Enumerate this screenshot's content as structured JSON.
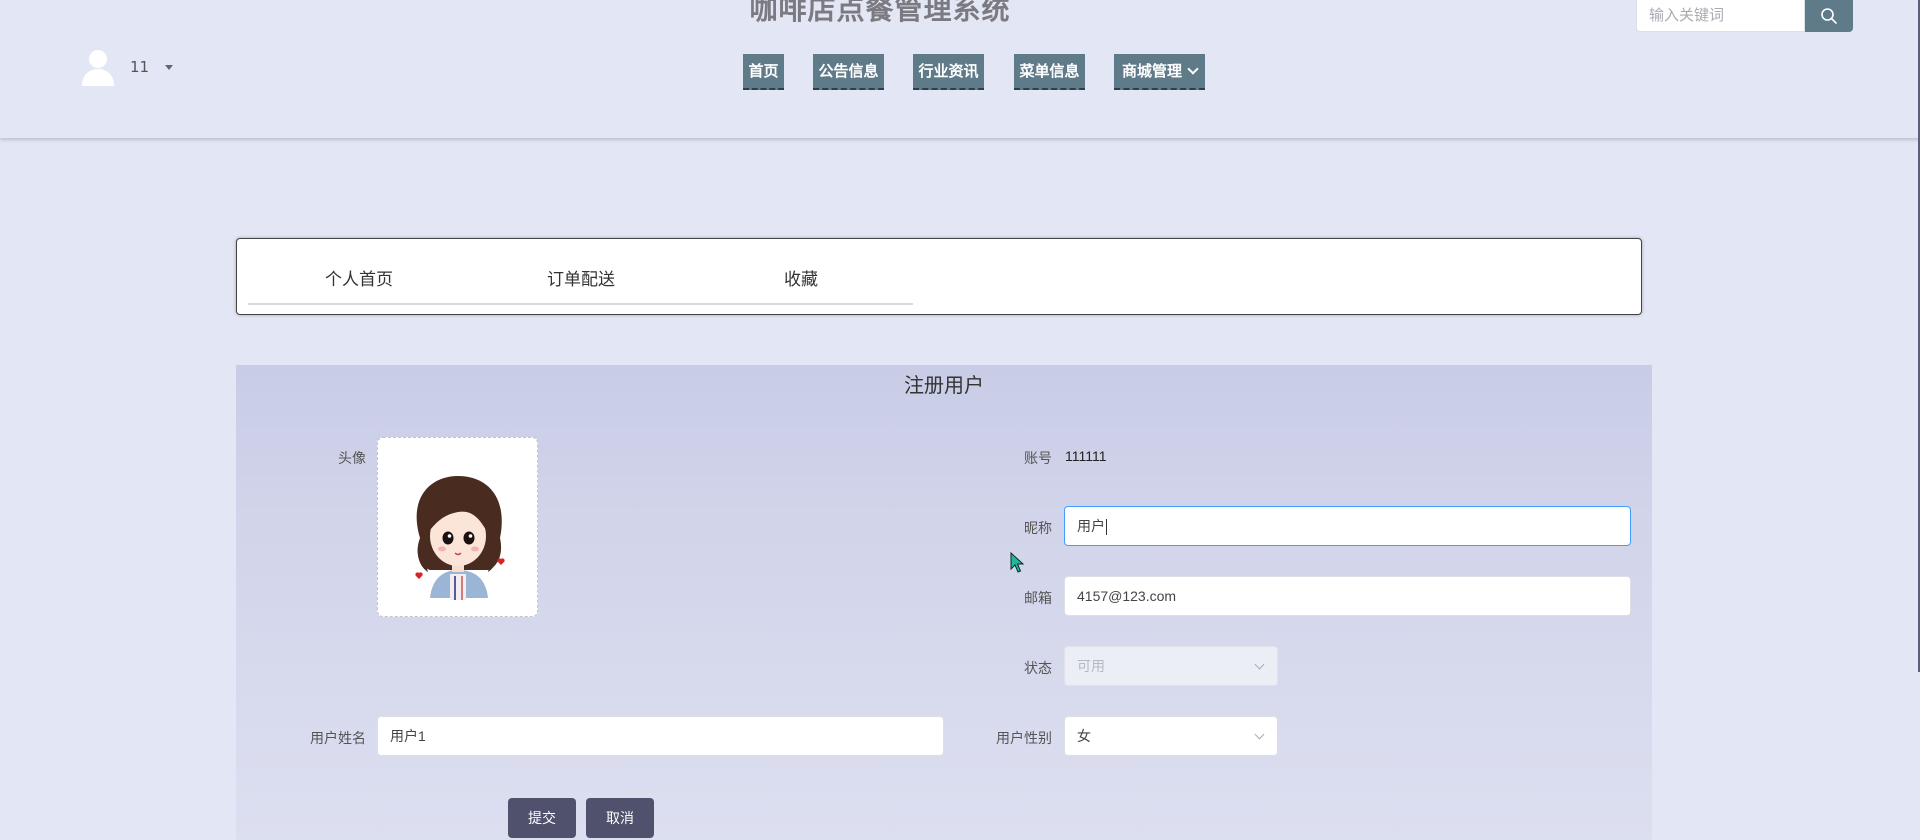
{
  "header": {
    "site_title": "咖啡店点餐管理系统",
    "user_name": "11",
    "nav": [
      {
        "label": "首页"
      },
      {
        "label": "公告信息"
      },
      {
        "label": "行业资讯"
      },
      {
        "label": "菜单信息"
      },
      {
        "label": "商城管理",
        "has_dropdown": true
      }
    ],
    "search": {
      "placeholder": "输入关键词",
      "value": ""
    }
  },
  "tabs": [
    {
      "label": "个人首页"
    },
    {
      "label": "订单配送"
    },
    {
      "label": "收藏"
    }
  ],
  "form": {
    "title": "注册用户",
    "avatar_label": "头像",
    "account_label": "账号",
    "account_value": "111111",
    "nickname_label": "昵称",
    "nickname_value": "用户",
    "email_label": "邮箱",
    "email_value": "4157@123.com",
    "status_label": "状态",
    "status_value": "可用",
    "realname_label": "用户姓名",
    "realname_value": "用户1",
    "gender_label": "用户性别",
    "gender_value": "女",
    "submit_label": "提交",
    "cancel_label": "取消"
  },
  "icons": {
    "user": "user-icon",
    "caret": "caret-down-icon",
    "search": "search-icon",
    "chevron": "chevron-down-icon",
    "cursor": "mouse-cursor-icon"
  },
  "colors": {
    "page_bg": "#e3e6f4",
    "nav_bg": "#5f7a88",
    "button_bg": "#4f516d",
    "focus_border": "#409eff"
  }
}
